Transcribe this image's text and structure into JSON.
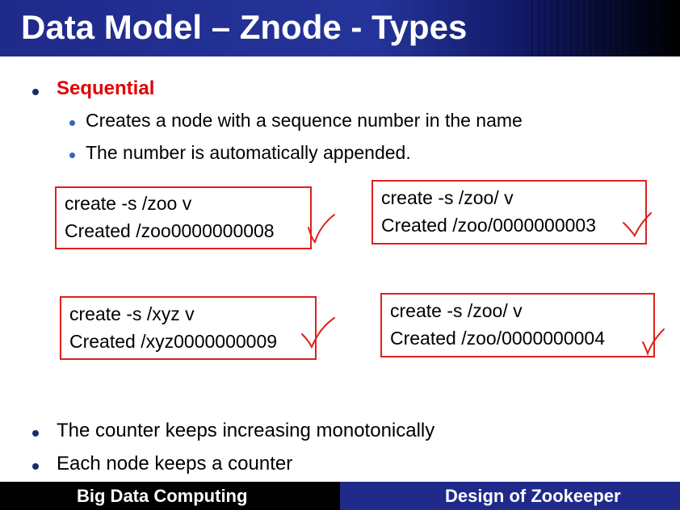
{
  "slide": {
    "title": "Data Model – Znode - Types",
    "bullets": {
      "sequential_label": "Sequential",
      "sub1": "Creates a node with a sequence number in the name",
      "sub2": "The number is automatically appended."
    },
    "boxes": [
      {
        "cmd": "create -s /zoo v",
        "result": "Created /zoo0000000008"
      },
      {
        "cmd": "create -s /zoo/ v",
        "result": "Created /zoo/0000000003"
      },
      {
        "cmd": "create -s /xyz v",
        "result": "Created /xyz0000000009"
      },
      {
        "cmd": "create -s /zoo/ v",
        "result": "Created /zoo/0000000004"
      }
    ],
    "bottom_bullets": [
      "The counter keeps increasing monotonically",
      "Each node keeps a counter"
    ],
    "footer": {
      "left": "Big Data Computing",
      "right": "Design of Zookeeper"
    },
    "colors": {
      "title_bg": "#25349a",
      "highlight": "#e00000",
      "box_border": "#e0201c",
      "footer_left": "#000000",
      "footer_right": "#1f2a8a"
    }
  }
}
